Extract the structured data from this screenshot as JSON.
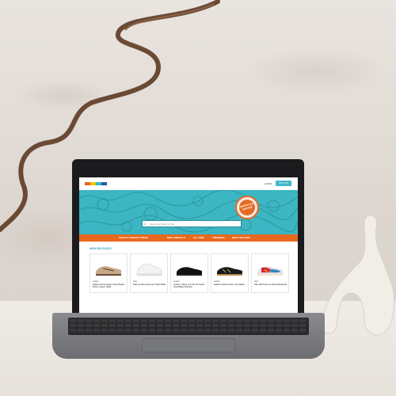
{
  "colors": {
    "accent": "#3bb6c2",
    "nav": "#e8681f",
    "signin": "#3fb8c9"
  },
  "header": {
    "logo_name": "logo",
    "nav_link": "LOGIN",
    "signin_label": "SIGN UP"
  },
  "hero": {
    "search_placeholder": "Search by brand or title",
    "badge_text": "ZEROSCALE SERVICE"
  },
  "nav": {
    "items": [
      "SHOP BY SNEAKY PRICE",
      "NEW ARRIVALS",
      "ALL NEW",
      "TRENDING",
      "BEST SELLERS"
    ]
  },
  "section": {
    "title": "NEW RELEASES"
  },
  "products": [
    {
      "brand": "adidas",
      "name": "adidas Samba Vegan Velvet Maker Brown Cream White",
      "icon": "sneaker-tan"
    },
    {
      "brand": "Nike",
      "name": "Nike Air More Uptempo Triple White",
      "icon": "sneaker-white"
    },
    {
      "brand": "Jordan",
      "name": "Jordan 1 Retro Low OG SP Travis Scott Black Phantom",
      "icon": "sneaker-black"
    },
    {
      "brand": "adidas",
      "name": "adidas Gazelle Indoor Core Black",
      "icon": "sneaker-black-gum"
    },
    {
      "brand": "Nike",
      "name": "Nike SB Dunk Low Sandy Bodecker",
      "icon": "sneaker-multicolor"
    }
  ]
}
